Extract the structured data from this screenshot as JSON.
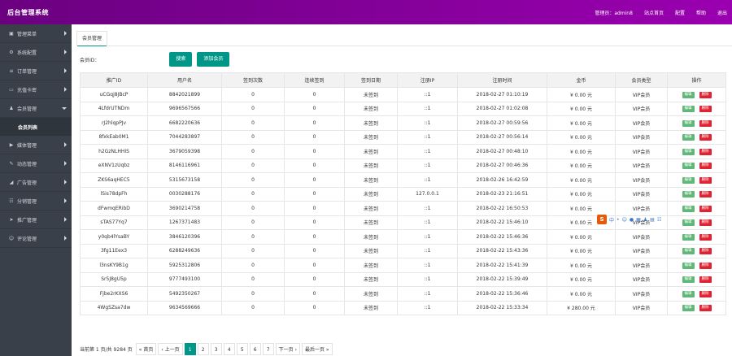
{
  "header": {
    "title": "后台管理系统",
    "nav": [
      "管理员：admin8",
      "站点首页",
      "配置",
      "帮助",
      "退出"
    ]
  },
  "sidebar": {
    "items": [
      {
        "icon": "▣",
        "label": "管理菜单"
      },
      {
        "icon": "⚙",
        "label": "系统配置"
      },
      {
        "icon": "≡",
        "label": "订单管理"
      },
      {
        "icon": "▭",
        "label": "充值卡密"
      },
      {
        "icon": "♟",
        "label": "会员管理"
      },
      {
        "icon": "▶",
        "label": "媒体管理"
      },
      {
        "icon": "✎",
        "label": "动态管理"
      },
      {
        "icon": "◢",
        "label": "广告管理"
      },
      {
        "icon": "☷",
        "label": "分销管理"
      },
      {
        "icon": "➤",
        "label": "推广管理"
      },
      {
        "icon": "☺",
        "label": "评论管理"
      }
    ],
    "submenu_label": "会员列表"
  },
  "tab": {
    "label": "会员管理"
  },
  "search": {
    "label": "会员ID：",
    "placeholder": "",
    "search_btn": "搜索",
    "add_btn": "添加会员"
  },
  "table": {
    "columns": [
      "推广ID",
      "用户名",
      "签到次数",
      "连续签到",
      "签到日期",
      "注册IP",
      "注册时间",
      "金币",
      "会员类型",
      "操作"
    ],
    "edit_label": "编辑",
    "delete_label": "删除",
    "rows": [
      [
        "uCGqj8JBcP",
        "8842021899",
        "0",
        "0",
        "未签到",
        "::1",
        "2018-02-27 01:10:19",
        "¥ 0.00 元",
        "VIP会员"
      ],
      [
        "4LfdrUTNDm",
        "9696567566",
        "0",
        "0",
        "未签到",
        "::1",
        "2018-02-27 01:02:08",
        "¥ 0.00 元",
        "VIP会员"
      ],
      [
        "rJ2hlqpPJv",
        "6682220636",
        "0",
        "0",
        "未签到",
        "::1",
        "2018-02-27 00:59:56",
        "¥ 0.00 元",
        "VIP会员"
      ],
      [
        "8fxkEab0M1",
        "7044283897",
        "0",
        "0",
        "未签到",
        "::1",
        "2018-02-27 00:56:14",
        "¥ 0.00 元",
        "VIP会员"
      ],
      [
        "h2GzNLHHIS",
        "3679059398",
        "0",
        "0",
        "未签到",
        "::1",
        "2018-02-27 00:48:10",
        "¥ 0.00 元",
        "VIP会员"
      ],
      [
        "eXNV1zUqbz",
        "8146116961",
        "0",
        "0",
        "未签到",
        "::1",
        "2018-02-27 00:46:36",
        "¥ 0.00 元",
        "VIP会员"
      ],
      [
        "ZKS6aqHEC5",
        "5315673158",
        "0",
        "0",
        "未签到",
        "::1",
        "2018-02-26 16:42:59",
        "¥ 0.00 元",
        "VIP会员"
      ],
      [
        "lSis78dpFh",
        "0030288176",
        "0",
        "0",
        "未签到",
        "127.0.0.1",
        "2018-02-23 21:16:51",
        "¥ 0.00 元",
        "VIP会员"
      ],
      [
        "dFwmqERibD",
        "3690214758",
        "0",
        "0",
        "未签到",
        "::1",
        "2018-02-22 16:50:53",
        "¥ 0.00 元",
        "VIP会员"
      ],
      [
        "sTAS77Yq7",
        "1267371483",
        "0",
        "0",
        "未签到",
        "::1",
        "2018-02-22 15:46:10",
        "¥ 0.00 元",
        "VIP会员"
      ],
      [
        "y0qb4lYsaBY",
        "3846120396",
        "0",
        "0",
        "未签到",
        "::1",
        "2018-02-22 15:46:36",
        "¥ 0.00 元",
        "VIP会员"
      ],
      [
        "3fg11Eex3",
        "6288249636",
        "0",
        "0",
        "未签到",
        "::1",
        "2018-02-22 15:43:36",
        "¥ 0.00 元",
        "VIP会员"
      ],
      [
        "l3nsKY9B1g",
        "5925312806",
        "0",
        "0",
        "未签到",
        "::1",
        "2018-02-22 15:41:39",
        "¥ 0.00 元",
        "VIP会员"
      ],
      [
        "Sr5J8gU5p",
        "9777493100",
        "0",
        "0",
        "未签到",
        "::1",
        "2018-02-22 15:39:49",
        "¥ 0.00 元",
        "VIP会员"
      ],
      [
        "Fjbe2rKXS6",
        "5492350267",
        "0",
        "0",
        "未签到",
        "::1",
        "2018-02-22 15:36:46",
        "¥ 0.00 元",
        "VIP会员"
      ],
      [
        "4WgSZsa7dw",
        "9634569666",
        "0",
        "0",
        "未签到",
        "::1",
        "2018-02-22 15:33:34",
        "¥ 280.00 元",
        "VIP会员"
      ]
    ]
  },
  "pager": {
    "info": "当前第 1 页/共 9284 页",
    "items": [
      "« 首页",
      "‹ 上一页",
      "1",
      "2",
      "3",
      "4",
      "5",
      "6",
      "7",
      "下一页 ›",
      "最后一页 »"
    ],
    "current": "1"
  },
  "ime": {
    "logo": "S",
    "glyphs": [
      "中",
      "•",
      "☺",
      "●",
      "▦",
      "♟",
      "▤",
      "☷"
    ]
  }
}
